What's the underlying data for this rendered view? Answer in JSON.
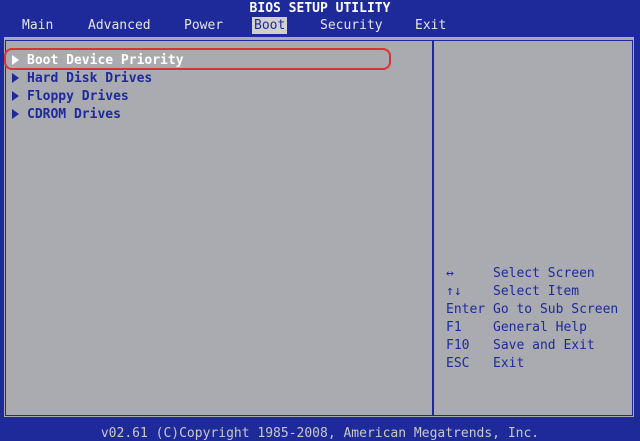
{
  "header": {
    "title": "BIOS SETUP UTILITY",
    "tabs": [
      {
        "label": "Main",
        "active": false
      },
      {
        "label": "Advanced",
        "active": false
      },
      {
        "label": "Power",
        "active": false
      },
      {
        "label": "Boot",
        "active": true
      },
      {
        "label": "Security",
        "active": false
      },
      {
        "label": "Exit",
        "active": false
      }
    ]
  },
  "boot_menu": {
    "items": [
      {
        "label": "Boot Device Priority",
        "selected": true
      },
      {
        "label": "Hard Disk Drives",
        "selected": false
      },
      {
        "label": "Floppy Drives",
        "selected": false
      },
      {
        "label": "CDROM Drives",
        "selected": false
      }
    ]
  },
  "help": {
    "rows": [
      {
        "key": "↔",
        "desc": "Select Screen"
      },
      {
        "key": "↑↓",
        "desc": "Select Item"
      },
      {
        "key": "Enter",
        "desc": "Go to Sub Screen"
      },
      {
        "key": "F1",
        "desc": "General Help"
      },
      {
        "key": "F10",
        "desc": "Save and Exit"
      },
      {
        "key": "ESC",
        "desc": "Exit"
      }
    ]
  },
  "footer": {
    "text": "v02.61 (C)Copyright 1985-2008, American Megatrends, Inc."
  },
  "colors": {
    "background": "#1e2a9a",
    "panel": "#a9abb0",
    "highlight": "#e03030",
    "text_selected": "#ffffff"
  }
}
